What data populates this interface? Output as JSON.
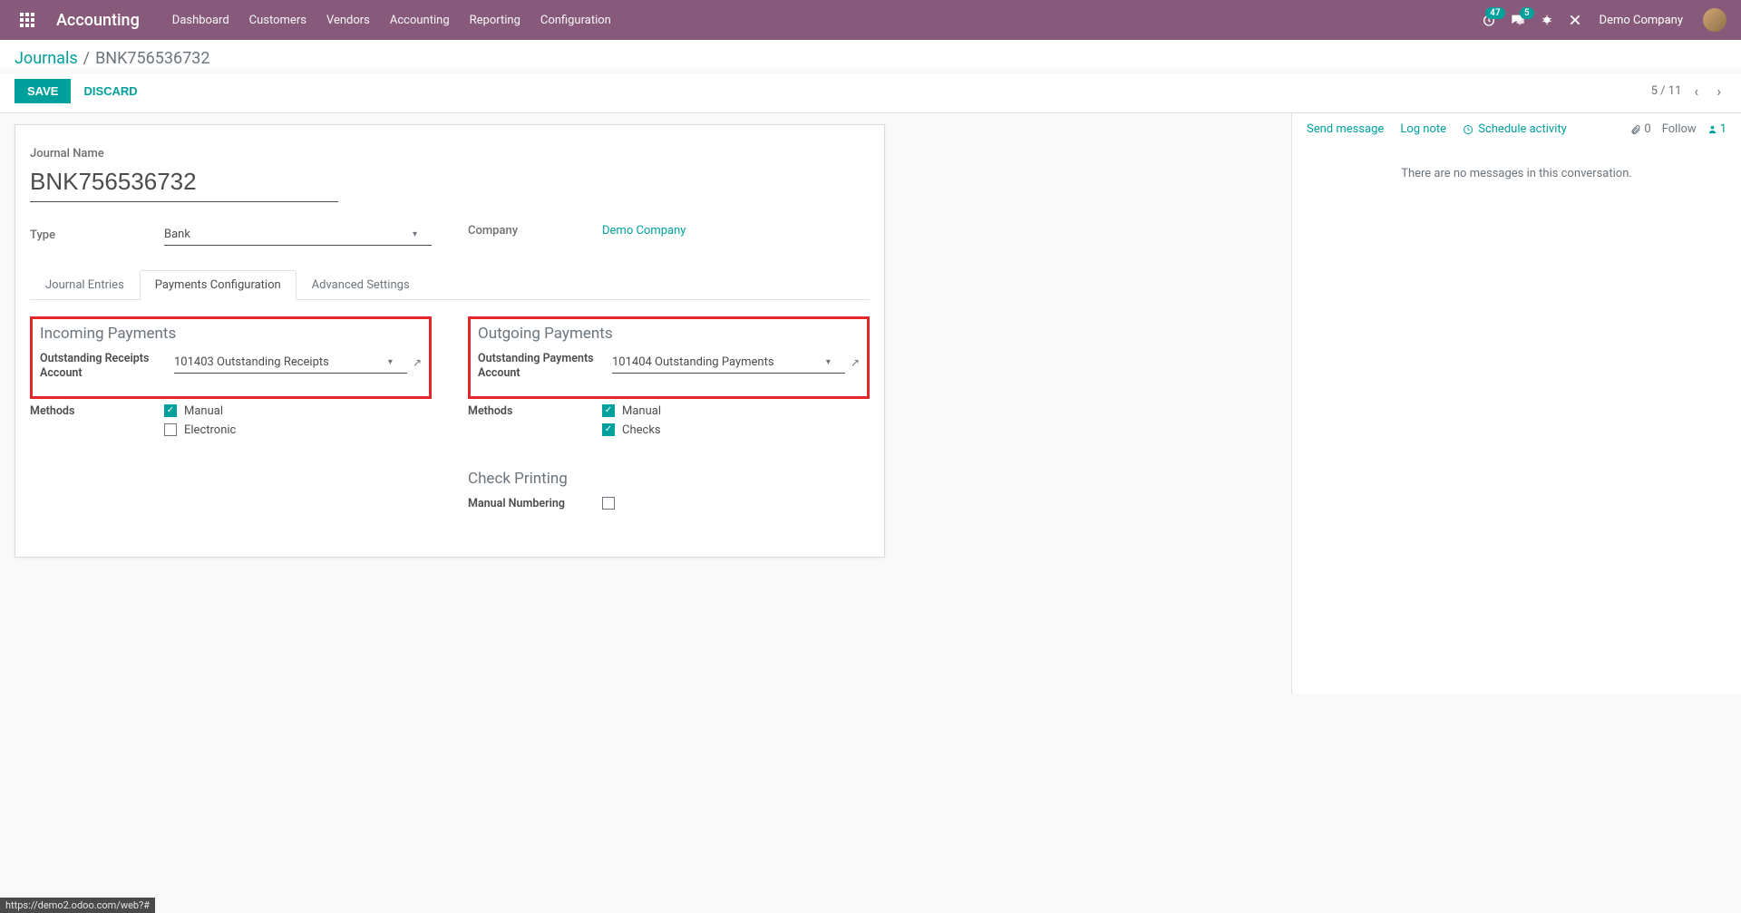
{
  "navbar": {
    "app_title": "Accounting",
    "links": [
      "Dashboard",
      "Customers",
      "Vendors",
      "Accounting",
      "Reporting",
      "Configuration"
    ],
    "timer_badge": "47",
    "chat_badge": "5",
    "company": "Demo Company"
  },
  "breadcrumb": {
    "root": "Journals",
    "current": "BNK756536732"
  },
  "actions": {
    "save": "SAVE",
    "discard": "DISCARD"
  },
  "pager": {
    "position": "5 / 11"
  },
  "form": {
    "name_label": "Journal Name",
    "name_value": "BNK756536732",
    "type_label": "Type",
    "type_value": "Bank",
    "company_label": "Company",
    "company_value": "Demo Company"
  },
  "tabs": {
    "entries": "Journal Entries",
    "payments": "Payments Configuration",
    "advanced": "Advanced Settings"
  },
  "incoming": {
    "title": "Incoming Payments",
    "account_label": "Outstanding Receipts Account",
    "account_value": "101403 Outstanding Receipts",
    "methods_label": "Methods",
    "method_manual": "Manual",
    "method_electronic": "Electronic"
  },
  "outgoing": {
    "title": "Outgoing Payments",
    "account_label": "Outstanding Payments Account",
    "account_value": "101404 Outstanding Payments",
    "methods_label": "Methods",
    "method_manual": "Manual",
    "method_checks": "Checks"
  },
  "check_printing": {
    "title": "Check Printing",
    "manual_label": "Manual Numbering"
  },
  "chatter": {
    "send": "Send message",
    "log": "Log note",
    "schedule": "Schedule activity",
    "attach_count": "0",
    "follow": "Follow",
    "follower_count": "1",
    "empty": "There are no messages in this conversation."
  },
  "status_url": "https://demo2.odoo.com/web?#"
}
